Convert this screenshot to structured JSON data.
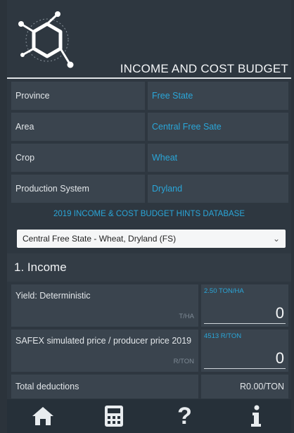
{
  "header": {
    "title": "INCOME AND COST BUDGET"
  },
  "fields": [
    {
      "label": "Province",
      "value": "Free State"
    },
    {
      "label": "Area",
      "value": "Central Free Sate"
    },
    {
      "label": "Crop",
      "value": "Wheat"
    },
    {
      "label": "Production System",
      "value": "Dryland"
    }
  ],
  "hints_db": "2019 INCOME & COST BUDGET HINTS DATABASE",
  "select": {
    "value": "Central Free State - Wheat, Dryland (FS)"
  },
  "section": {
    "title": "1. Income"
  },
  "yield": {
    "label": "Yield: Deterministic",
    "unit": "T/HA",
    "hint": "2.50 TON/HA",
    "value": "0"
  },
  "safex": {
    "label": "SAFEX simulated price / producer price 2019",
    "unit": "R/TON",
    "hint": "4513 R/TON",
    "value": "0"
  },
  "deductions": {
    "label": "Total deductions",
    "value": "R0.00/TON"
  },
  "nav": [
    {
      "icon": "home-icon"
    },
    {
      "icon": "calculator-icon"
    },
    {
      "icon": "help-icon",
      "glyph": "?"
    },
    {
      "icon": "info-icon"
    }
  ],
  "colors": {
    "accent": "#2aa6d8",
    "background": "#2e3740",
    "cell": "#3a444e",
    "nav": "#263039"
  }
}
